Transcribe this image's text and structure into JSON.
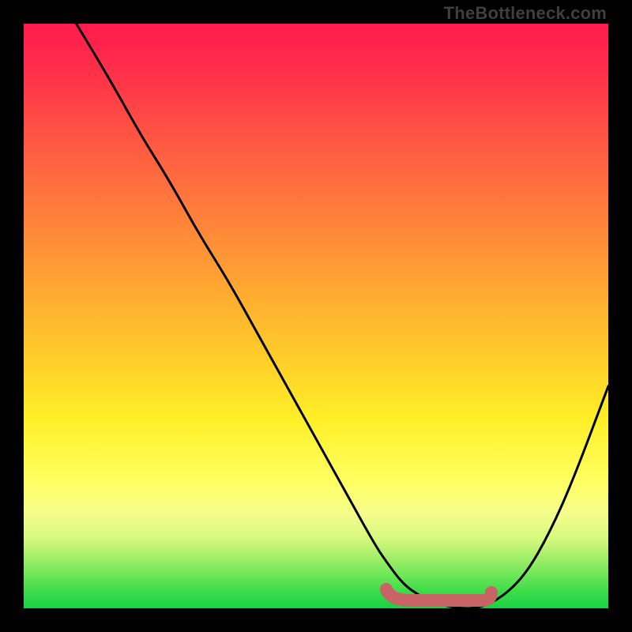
{
  "watermark": "TheBottleneck.com",
  "colors": {
    "frame": "#000000",
    "curve_stroke": "#000000",
    "marker": "#c86466",
    "gradient_top": "#ff1a4d",
    "gradient_bottom": "#18d242"
  },
  "chart_data": {
    "type": "line",
    "title": "",
    "xlabel": "",
    "ylabel": "",
    "xlim": [
      0,
      100
    ],
    "ylim": [
      0,
      100
    ],
    "grid": false,
    "series": [
      {
        "name": "bottleneck-curve",
        "x": [
          9,
          15,
          20,
          25,
          30,
          35,
          40,
          45,
          50,
          55,
          60,
          62,
          65,
          68,
          70,
          74,
          78,
          82,
          86,
          90,
          94,
          100
        ],
        "y": [
          100,
          90,
          81,
          73,
          64,
          56,
          47,
          38,
          29,
          20,
          11,
          8,
          4,
          2,
          1,
          0,
          0,
          2,
          6,
          13,
          22,
          38
        ]
      }
    ],
    "annotations": [
      {
        "name": "optimal-range-marker",
        "type": "segment",
        "x_start": 62,
        "x_end": 80,
        "y": 0,
        "comment": "salmon-pink marker hugging x-axis at curve minimum"
      }
    ]
  }
}
